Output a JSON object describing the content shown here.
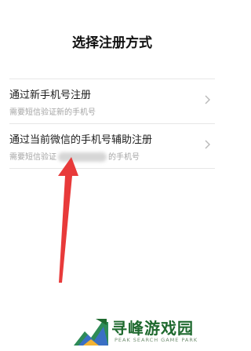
{
  "page": {
    "title": "选择注册方式"
  },
  "options": [
    {
      "title": "通过新手机号注册",
      "subtitle": "需要短信验证新的手机号"
    },
    {
      "title": "通过当前微信的手机号辅助注册",
      "subtitle_prefix": "需要短信验证",
      "subtitle_suffix": "的手机号"
    }
  ],
  "icons": {
    "chevron": "chevron-right-icon",
    "arrow": "arrow-up-annotation"
  },
  "watermark": {
    "cn": "寻峰游戏园",
    "en": "PEAK SEARCH GAME PARK"
  },
  "colors": {
    "annotation_arrow": "#e83a3a",
    "watermark_green": "#1f6a2f"
  }
}
